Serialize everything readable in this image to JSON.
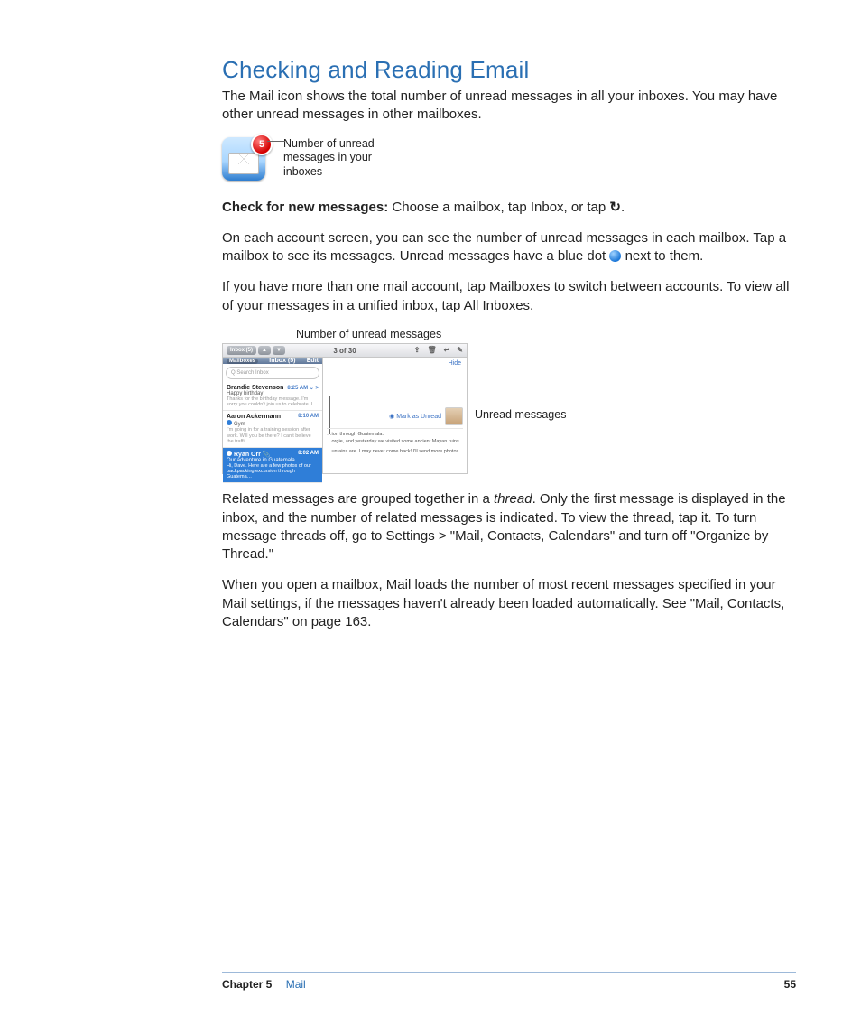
{
  "heading": "Checking and Reading Email",
  "intro": "The Mail icon shows the total number of unread messages in all your inboxes. You may have other unread messages in other mailboxes.",
  "mail_icon": {
    "badge_count": "5",
    "caption": "Number of unread messages in your inboxes"
  },
  "check_line": {
    "label": "Check for new messages:",
    "rest_before_icon": "  Choose a mailbox, tap Inbox, or tap ",
    "rest_after_icon": "."
  },
  "para_account": "On each account screen, you can see the number of unread messages in each mailbox. Tap a mailbox to see its messages. Unread messages have a blue dot ",
  "para_account_after": " next to them.",
  "para_multi": "If you have more than one mail account, tap Mailboxes to switch between accounts. To view all of your messages in a unified inbox, tap All Inboxes.",
  "figure2": {
    "caption_top": "Number of unread messages",
    "caption_side": "Unread messages",
    "topbar": {
      "left_label": "Inbox (5)",
      "up": "▲",
      "down": "▼",
      "center": "3 of 30",
      "icons": [
        "⇪",
        "🗑",
        "↩",
        "✎"
      ]
    },
    "sidebar": {
      "back": "Mailboxes",
      "title": "Inbox (5)",
      "edit": "Edit",
      "search_placeholder": "Q  Search Inbox",
      "messages": [
        {
          "from": "Brandie Stevenson",
          "time": "8:25 AM",
          "subject": "Happy birthday",
          "preview": "Thanks for the birthday message. I'm sorry you couldn't join us to celebrate. I…",
          "unread": false,
          "selected": false,
          "chevron": "⌄ >"
        },
        {
          "from": "Aaron Ackermann",
          "time": "8:10 AM",
          "subject": "Gym",
          "preview": "I'm going in for a training session after work. Will you be there? I can't believe the traffi…",
          "unread": true,
          "selected": false
        },
        {
          "from": "Ryan Orr",
          "time": "8:02 AM",
          "subject": "Our adventure in Guatemala",
          "preview": "Hi, Dave. Here are a few photos of our backpacking excursion through Guatema…",
          "unread": true,
          "selected": true
        }
      ]
    },
    "main": {
      "hide": "Hide",
      "mark": "◉ Mark as Unread",
      "body_frag1": "…ion through Guatemala.",
      "body_frag2": "…orgie, and yesterday we visited some ancient Mayan ruins.",
      "body_frag3": "…untains are. I may never come back! I'll send more photos"
    }
  },
  "para_thread_before": "Related messages are grouped together in a ",
  "para_thread_italic": "thread",
  "para_thread_after": ". Only the first message is displayed in the inbox, and the number of related messages is indicated. To view the thread, tap it. To turn message threads off, go to Settings > \"Mail, Contacts, Calendars\" and turn off \"Organize by Thread.\"",
  "para_load": "When you open a mailbox, Mail loads the number of most recent messages specified in your Mail settings, if the messages haven't already been loaded automatically. See \"Mail, Contacts, Calendars\" on page 163.",
  "footer": {
    "chapter": "Chapter 5",
    "title": "Mail",
    "page": "55"
  }
}
